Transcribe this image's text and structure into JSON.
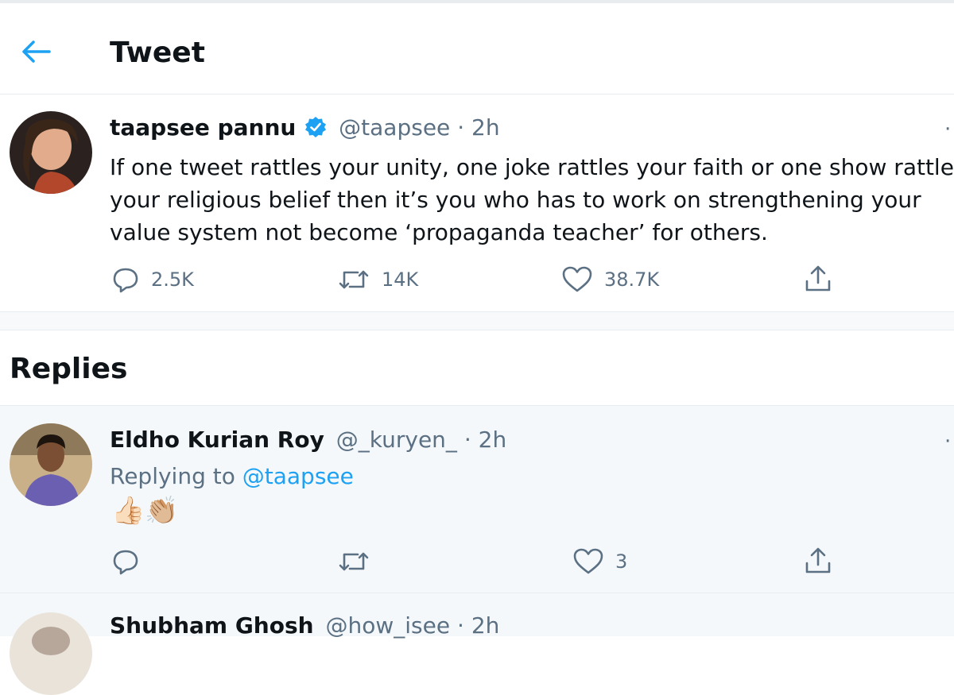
{
  "header": {
    "title": "Tweet"
  },
  "tweet": {
    "name": "taapsee pannu",
    "handle": "@taapsee",
    "separator": "·",
    "time": "2h",
    "text": "If one tweet rattles your unity, one joke rattles your faith or one show rattle\nyour religious belief then it’s you who has to work on strengthening your\nvalue system not become ‘propaganda teacher’ for others.",
    "reply_count": "2.5K",
    "retweet_count": "14K",
    "like_count": "38.7K"
  },
  "replies_heading": "Replies",
  "replies": [
    {
      "name": "Eldho Kurian Roy",
      "handle": "@_kuryen_",
      "separator": "·",
      "time": "2h",
      "replying_prefix": "Replying to",
      "replying_to": "@taapsee",
      "emoji": "👍🏻👏🏼",
      "like_count": "3"
    },
    {
      "name": "Shubham Ghosh",
      "handle": "@how_isee",
      "separator": "·",
      "time": "2h"
    }
  ],
  "colors": {
    "accent": "#1da1f2",
    "muted": "#5b7083",
    "text": "#0f1419"
  },
  "icons": [
    "back-arrow-icon",
    "verified-badge-icon",
    "reply-icon",
    "retweet-icon",
    "like-icon",
    "share-icon",
    "more-icon"
  ]
}
